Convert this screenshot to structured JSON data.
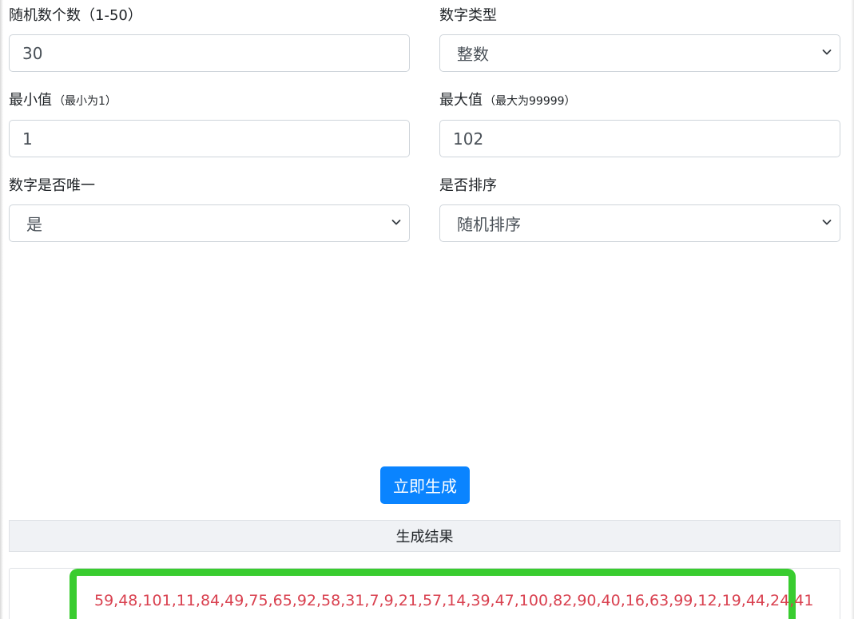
{
  "form": {
    "count": {
      "label": "随机数个数（1-50）",
      "value": "30"
    },
    "number_type": {
      "label": "数字类型",
      "selected": "整数"
    },
    "min": {
      "label": "最小值",
      "hint": "（最小为1）",
      "value": "1"
    },
    "max": {
      "label": "最大值",
      "hint": "（最大为99999）",
      "value": "102"
    },
    "unique": {
      "label": "数字是否唯一",
      "selected": "是"
    },
    "sort": {
      "label": "是否排序",
      "selected": "随机排序"
    }
  },
  "generate_button": {
    "label": "立即生成"
  },
  "result": {
    "header": "生成结果",
    "numbers": "59,48,101,11,84,49,75,65,92,58,31,7,9,21,57,14,39,47,100,82,90,40,16,63,99,12,19,44,24,41"
  },
  "colors": {
    "button": "#0a84ff",
    "result_text": "#d9404f",
    "highlight_border": "#39cc2f"
  }
}
